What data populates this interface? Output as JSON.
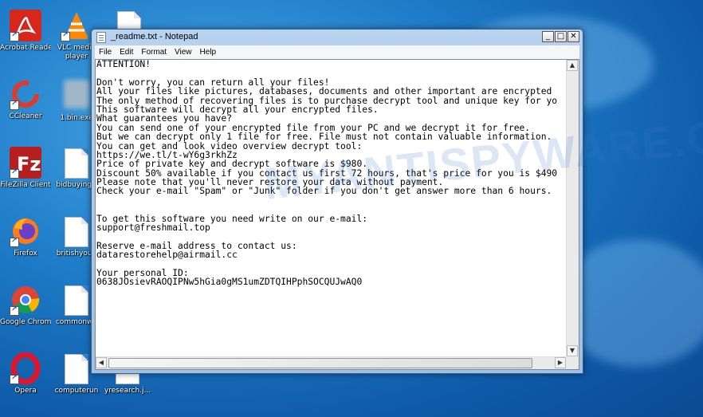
{
  "desktop": {
    "icons": [
      {
        "label": "Acrobat Reader DC",
        "icon": "acrobat-icon"
      },
      {
        "label": "VLC media player",
        "icon": "vlc-icon"
      },
      {
        "label": "CCleaner",
        "icon": "ccleaner-icon"
      },
      {
        "label": "1.bin.exe",
        "icon": "exe-icon"
      },
      {
        "label": "FileZilla Client",
        "icon": "filezilla-icon"
      },
      {
        "label": "bidbuying.r",
        "icon": "file-icon"
      },
      {
        "label": "Firefox",
        "icon": "firefox-icon"
      },
      {
        "label": "britishyoun",
        "icon": "file-icon"
      },
      {
        "label": "Google Chrome",
        "icon": "chrome-icon"
      },
      {
        "label": "commonwh",
        "icon": "file-icon"
      },
      {
        "label": "Opera",
        "icon": "opera-icon"
      },
      {
        "label": "computerun",
        "icon": "file-icon"
      },
      {
        "label": "yresearch.j...",
        "icon": "file-icon"
      }
    ]
  },
  "watermark": "MYANTISPYWARE.C",
  "notepad": {
    "title": "_readme.txt - Notepad",
    "window_buttons": {
      "minimize": "_",
      "maximize": "□",
      "close": "✕"
    },
    "menu": [
      "File",
      "Edit",
      "Format",
      "View",
      "Help"
    ],
    "lines": [
      "ATTENTION!",
      "",
      "Don't worry, you can return all your files!",
      "All your files like pictures, databases, documents and other important are encrypted",
      "The only method of recovering files is to purchase decrypt tool and unique key for yo",
      "This software will decrypt all your encrypted files.",
      "What guarantees you have?",
      "You can send one of your encrypted file from your PC and we decrypt it for free.",
      "But we can decrypt only 1 file for free. File must not contain valuable information.",
      "You can get and look video overview decrypt tool:",
      "https://we.tl/t-wY6g3rkhZz",
      "Price of private key and decrypt software is $980.",
      "Discount 50% available if you contact us first 72 hours, that's price for you is $490",
      "Please note that you'll never restore your data without payment.",
      "Check your e-mail \"Spam\" or \"Junk\" folder if you don't get answer more than 6 hours.",
      "",
      "",
      "To get this software you need write on our e-mail:",
      "support@freshmail.top",
      "",
      "Reserve e-mail address to contact us:",
      "datarestorehelp@airmail.cc",
      "",
      "Your personal ID:",
      "0638JOsievRAOQIPNw5hGia0gMS1umZDTQIHPphSOCQUJwAQ0"
    ],
    "scroll_arrows": {
      "up": "▲",
      "down": "▼",
      "left": "◀",
      "right": "▶"
    }
  }
}
